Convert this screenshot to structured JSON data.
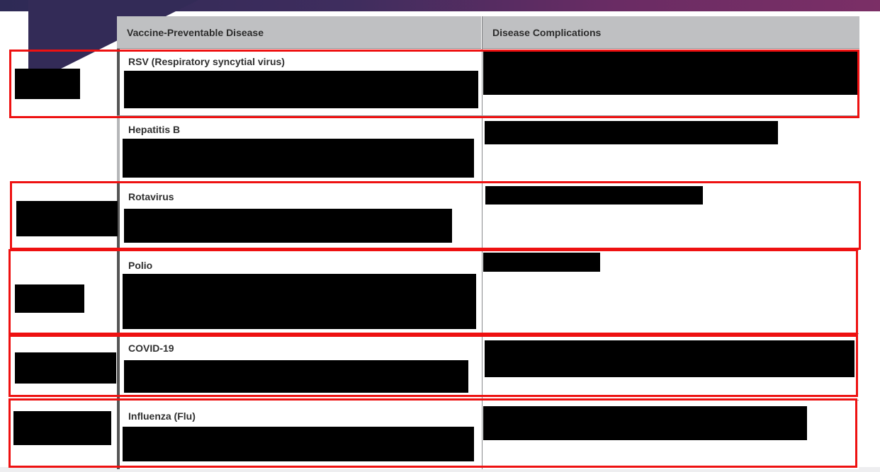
{
  "table": {
    "headers": [
      "Vaccine-Preventable Disease",
      "Disease Complications"
    ],
    "rows": [
      {
        "disease": "RSV (Respiratory syncytial virus)"
      },
      {
        "disease": "Hepatitis B"
      },
      {
        "disease": "Rotavirus"
      },
      {
        "disease": "Polio"
      },
      {
        "disease": "COVID-19"
      },
      {
        "disease": "Influenza (Flu)"
      }
    ]
  },
  "colors": {
    "highlight_box": "#ee1111",
    "redaction": "#000000",
    "header_bg": "#bfc0c2",
    "banner": "#3f2d5e"
  }
}
